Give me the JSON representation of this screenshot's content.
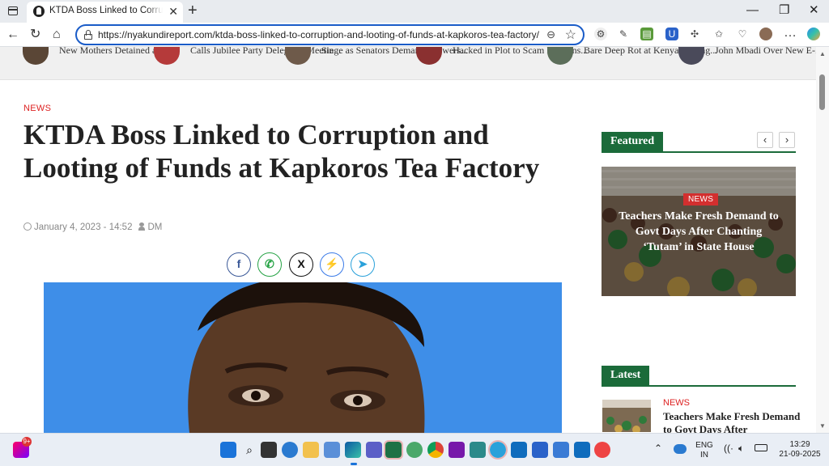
{
  "browser": {
    "tab_title": "KTDA Boss Linked to Corruption and Looting of Funds at Kapkoros Tea Factory",
    "tab_close": "✕",
    "new_tab": "+",
    "url": "https://nyakundireport.com/ktda-boss-linked-to-corruption-and-looting-of-funds-at-kapkoros-tea-factory/",
    "window_controls": {
      "minimize": "—",
      "restore": "❐",
      "close": "✕"
    },
    "nav": {
      "back": "←",
      "refresh": "↻",
      "home": "⌂",
      "more": "…"
    }
  },
  "ticker": [
    {
      "text": "New Mothers Detained and..."
    },
    {
      "text": "Calls Jubilee Party Delegates Meetin..."
    },
    {
      "text": "Siege as Senators Demand Answers..."
    },
    {
      "text": "Hacked in Plot to Scam Kenyans..."
    },
    {
      "text": "Bare Deep Rot at Kenya Fishing..."
    },
    {
      "text": "John Mbadi Over New E-..."
    }
  ],
  "article": {
    "category": "NEWS",
    "title": "KTDA Boss Linked to Corruption and Looting of Funds at Kapkoros Tea Factory",
    "date": "January 4, 2023 - 14:52",
    "author": "DM",
    "share": [
      {
        "name": "facebook",
        "glyph": "f",
        "color": "#3b5998"
      },
      {
        "name": "whatsapp",
        "glyph": "✆",
        "color": "#25a244"
      },
      {
        "name": "x",
        "glyph": "X",
        "color": "#111111"
      },
      {
        "name": "messenger",
        "glyph": "⚡",
        "color": "#3b7be8"
      },
      {
        "name": "telegram",
        "glyph": "➤",
        "color": "#2aa1da"
      }
    ]
  },
  "sidebar": {
    "featured_label": "Featured",
    "prev": "‹",
    "next": "›",
    "featured": {
      "category": "NEWS",
      "title": "Teachers Make Fresh Demand to Govt Days After Chanting ‘Tutam’ in State House"
    },
    "latest_label": "Latest",
    "latest": {
      "category": "NEWS",
      "title": "Teachers Make Fresh Demand to Govt Days After"
    }
  },
  "taskbar": {
    "notification_badge": "9+",
    "lang_line1": "ENG",
    "lang_line2": "IN",
    "time": "13:29",
    "date": "21-09-2025"
  },
  "colors": {
    "accent_green": "#1b6b3a",
    "news_red": "#dd2222",
    "url_border": "#1a5cc8",
    "hero_blue": "#3e8ee8"
  }
}
